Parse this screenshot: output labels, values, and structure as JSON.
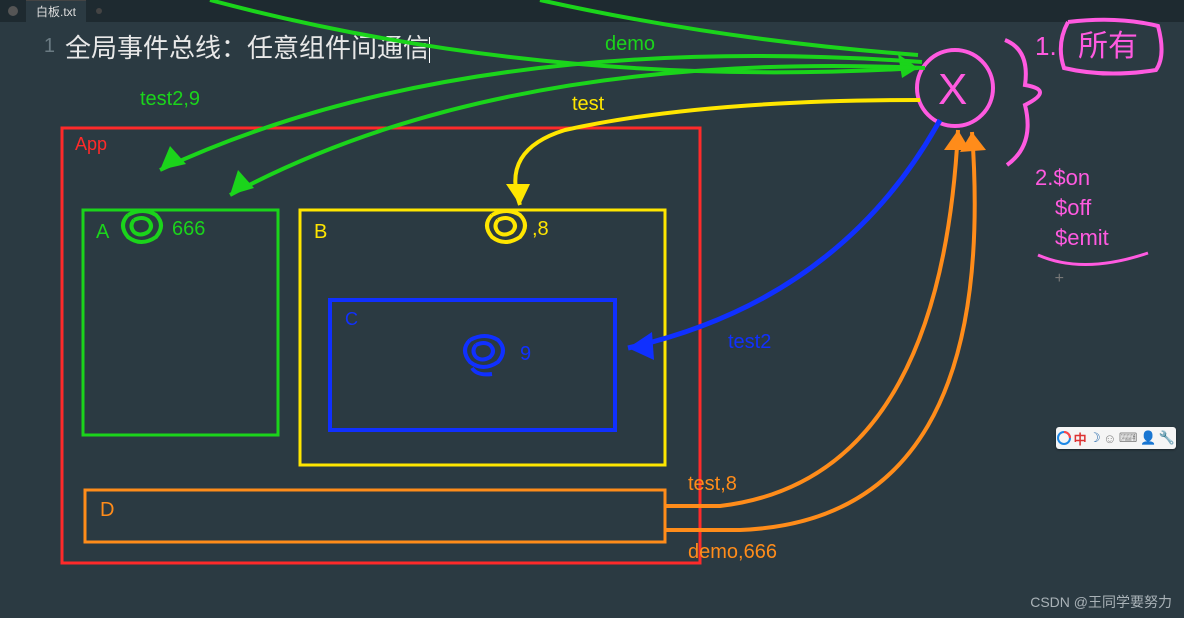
{
  "tab": {
    "filename": "白板.txt"
  },
  "editor": {
    "line_number": "1",
    "title": "全局事件总线：任意组件间通信"
  },
  "diagram": {
    "app_label": "App",
    "boxes": {
      "A": {
        "label": "A",
        "value": "666"
      },
      "B": {
        "label": "B",
        "value": ",8"
      },
      "C": {
        "label": "C",
        "value": "9"
      },
      "D": {
        "label": "D"
      }
    },
    "arrows": {
      "green_top": "demo",
      "green_left": "test2,9",
      "yellow_top": "test",
      "blue": "test2",
      "orange_top": "test,8",
      "orange_bottom": "demo,666"
    },
    "bus": {
      "symbol": "X",
      "note1_prefix": "1.",
      "note1_text": "所有",
      "note2_lines": [
        "2.$on",
        "$off",
        "$emit"
      ]
    }
  },
  "ime": {
    "glyph_zhong": "中"
  },
  "watermark": "CSDN @王同学要努力"
}
